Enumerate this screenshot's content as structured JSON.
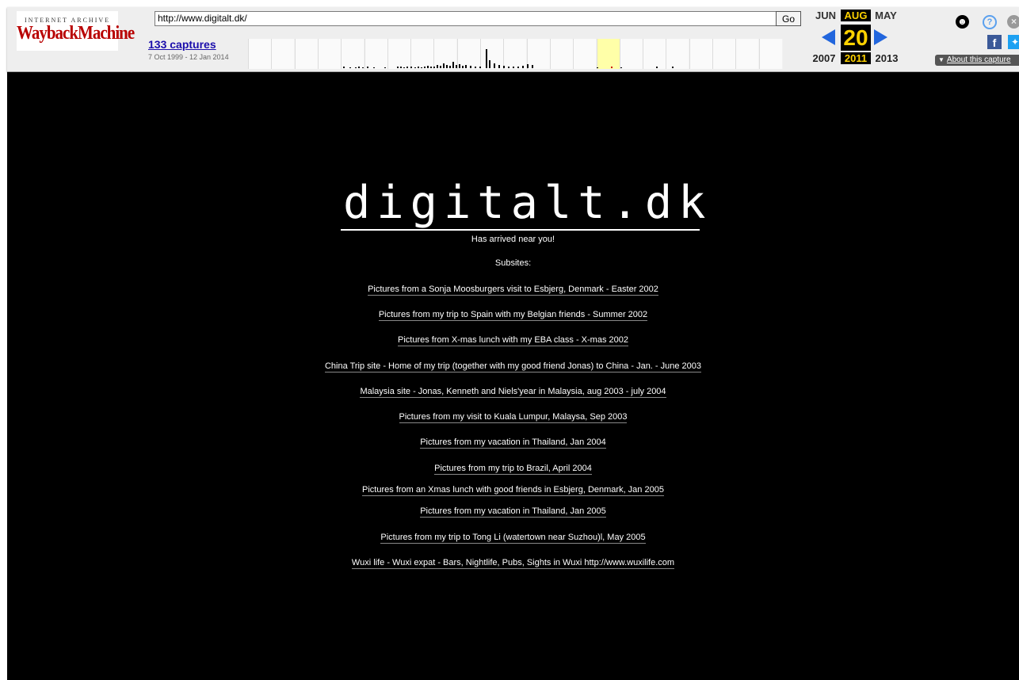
{
  "toolbar": {
    "logo_top": "INTERNET ARCHIVE",
    "logo_main": "WaybackMachine",
    "url_value": "http://www.digitalt.dk/",
    "go_label": "Go",
    "captures_label": "133 captures",
    "date_range": "7 Oct 1999 - 12 Jan 2014",
    "months": {
      "prev": "JUN",
      "current": "AUG",
      "next": "MAY"
    },
    "day": "20",
    "years": {
      "prev": "2007",
      "current": "2011",
      "next": "2013"
    },
    "about_label": "About this capture",
    "icons": [
      "user-icon",
      "help-icon",
      "close-icon",
      "facebook-icon",
      "twitter-icon",
      "prev-arrow-icon",
      "next-arrow-icon"
    ]
  },
  "site": {
    "logo": "digitalt.dk",
    "tagline": "Has arrived near you!",
    "subsites_label": "Subsites:",
    "links": [
      "Pictures from a Sonja Moosburgers visit to Esbjerg, Denmark - Easter 2002",
      "Pictures from my trip to Spain with my Belgian friends - Summer 2002",
      "Pictures from X-mas lunch with my EBA class - X-mas 2002",
      "China Trip site - Home of my trip (together with my good friend Jonas) to China - Jan. - June 2003",
      "Malaysia site - Jonas, Kenneth and Niels'year in Malaysia, aug 2003 - july 2004",
      "Pictures from my visit to Kuala Lumpur, Malaysa, Sep 2003",
      "Pictures from my vacation in Thailand, Jan 2004",
      "Pictures from my trip to Brazil, April 2004",
      "Pictures from an Xmas lunch with good friends in Esbjerg, Denmark, Jan 2005",
      "Pictures from my vacation in Thailand, Jan 2005",
      "Pictures from my trip to Tong Li (watertown near Suzhou)l, May 2005",
      "Wuxi life - Wuxi expat - Bars, Nightlife, Pubs, Sights in Wuxi http://www.wuxilife.com"
    ]
  },
  "colors": {
    "page_background": "#000000",
    "text": "#ffffff",
    "toolbar_background": "#eeeeee",
    "highlight": "#ffd200",
    "arrow": "#2266dd"
  }
}
